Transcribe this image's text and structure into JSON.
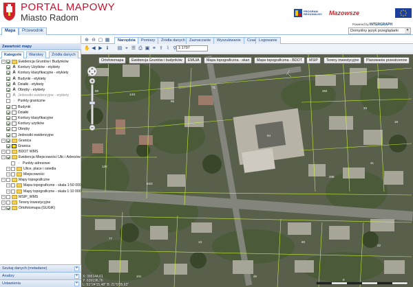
{
  "header": {
    "title": "PORTAL MAPOWY",
    "subtitle": "Miasto Radom",
    "logo_program": "PROGRAM REGIONALNY",
    "logo_mazowsze": "Mazowsze",
    "powered_by": "Powered by",
    "powered_brand": "INTERGRAPH"
  },
  "menu": {
    "tabs": [
      {
        "label": "Mapa"
      },
      {
        "label": "Przewodnik"
      }
    ]
  },
  "language": {
    "value": "Domyślny język przeglądarki"
  },
  "left_panel": {
    "title": "Zawartość mapy",
    "tabs": [
      {
        "label": "Kategorie"
      },
      {
        "label": "Warstwy"
      },
      {
        "label": "Źródła danych"
      }
    ],
    "tree": [
      {
        "label": "Ewidencja Gruntów i Budynków",
        "type": "folder",
        "level": 0,
        "checked": true
      },
      {
        "label": "Kontury Użytków - etykiety",
        "type": "label",
        "level": 1,
        "checked": true
      },
      {
        "label": "Kontury klasyfikacyjne - etykiety",
        "type": "label",
        "level": 1,
        "checked": true
      },
      {
        "label": "Budynki - etykiety",
        "type": "label",
        "level": 1,
        "checked": true
      },
      {
        "label": "Działki - etykiety",
        "type": "label",
        "level": 1,
        "checked": true
      },
      {
        "label": "Obręby - etykiety",
        "type": "label",
        "level": 1,
        "checked": true
      },
      {
        "label": "Jednostki ewidencyjne - etykiety",
        "type": "label",
        "level": 1,
        "checked": false,
        "dim": true
      },
      {
        "label": "Punkty graniczne",
        "type": "point",
        "level": 1,
        "checked": false
      },
      {
        "label": "Budynki",
        "type": "poly",
        "level": 1,
        "checked": true
      },
      {
        "label": "Działki",
        "type": "poly",
        "level": 1,
        "checked": true
      },
      {
        "label": "Kontury klasyfikacyjne",
        "type": "poly",
        "level": 1,
        "checked": true
      },
      {
        "label": "Kontury użytków",
        "type": "poly",
        "level": 1,
        "checked": true
      },
      {
        "label": "Obręby",
        "type": "poly",
        "level": 1,
        "checked": true
      },
      {
        "label": "Jednostki ewidencyjne",
        "type": "poly",
        "level": 1,
        "checked": true
      },
      {
        "label": "Granica",
        "type": "folder",
        "level": 0,
        "checked": true
      },
      {
        "label": "Granica",
        "type": "granica",
        "level": 1,
        "checked": true
      },
      {
        "label": "BDOT WMS",
        "type": "folder",
        "level": 0,
        "checked": false
      },
      {
        "label": "Ewidencja Miejscowości Ulic i Adresów",
        "type": "folder",
        "level": 0,
        "checked": true
      },
      {
        "label": "Punkty adresowe",
        "type": "point",
        "level": 2,
        "checked": false
      },
      {
        "label": "Ulice, place i osiedla",
        "type": "folder",
        "level": 1,
        "checked": false
      },
      {
        "label": "Miejscowości",
        "type": "folder",
        "level": 1,
        "checked": false
      },
      {
        "label": "Mapy topograficzne",
        "type": "folder",
        "level": 0,
        "checked": false
      },
      {
        "label": "Mapa topograficzne - skala 1:50 000",
        "type": "folder",
        "level": 1,
        "checked": false
      },
      {
        "label": "Mapy topograficzne - skala 1:10 000",
        "type": "folder",
        "level": 1,
        "checked": false
      },
      {
        "label": "MSIP_WMS",
        "type": "folder",
        "level": 0,
        "checked": false
      },
      {
        "label": "Tereny inwestycyjne",
        "type": "folder",
        "level": 0,
        "checked": false
      },
      {
        "label": "Ortofotomapa (GUGiK)",
        "type": "folder",
        "level": 0,
        "checked": true
      }
    ],
    "accordion": [
      {
        "label": "Szukaj danych (metadane)"
      },
      {
        "label": "Analizy"
      },
      {
        "label": "Ustawienia"
      }
    ]
  },
  "content_tabs": [
    {
      "label": "Narzędzia"
    },
    {
      "label": "Pomiary"
    },
    {
      "label": "Źródła danych"
    },
    {
      "label": "Zaznaczanie"
    },
    {
      "label": "Wyszukiwanie"
    },
    {
      "label": "Czas"
    },
    {
      "label": "Logowanie"
    }
  ],
  "toolbar": {
    "scale": "1:1797"
  },
  "layer_buttons": [
    {
      "label": "Ortofotomapa"
    },
    {
      "label": "Ewidencja Gruntów i budynków"
    },
    {
      "label": "EMUiA"
    },
    {
      "label": "Mapa topograficzna - skan"
    },
    {
      "label": "Mapa topograficzna - BDOT"
    },
    {
      "label": "MSIP"
    },
    {
      "label": "Tereny inwestycyjne"
    },
    {
      "label": "Planowanie przestrzenne"
    }
  ],
  "coords": {
    "line1": "X: 395144,61",
    "line2": "Y: 639196,76",
    "line3": "L: 51°24'15,48\" B: 21°9'35,93\""
  },
  "colors": {
    "accent": "#15428b",
    "brand_red": "#c8102e",
    "panel_border": "#99bbe8",
    "parcel_line": "#d4ff3a"
  }
}
